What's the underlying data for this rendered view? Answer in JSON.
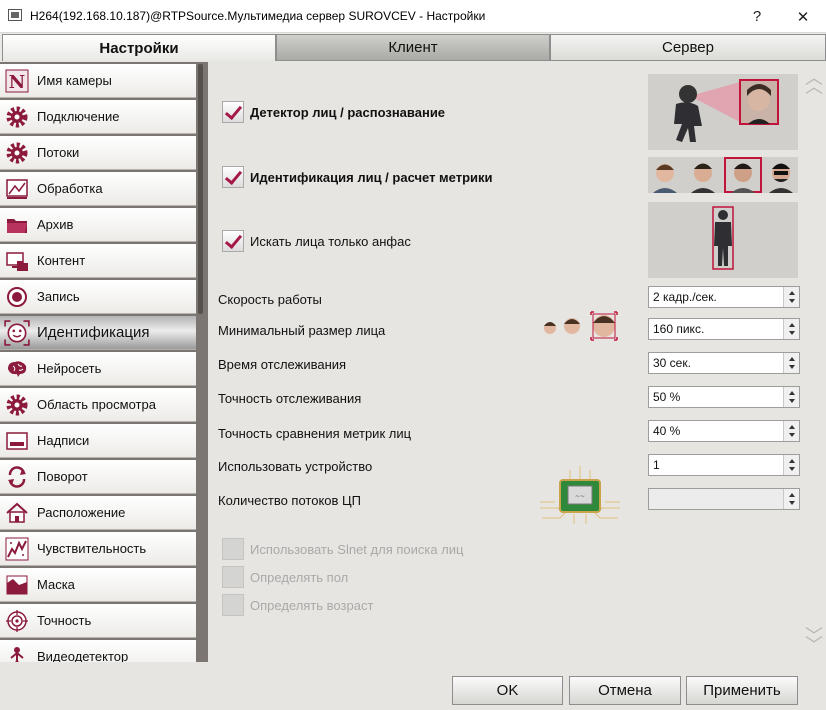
{
  "window": {
    "title": "H264(192.168.10.187)@RTPSource.Мультимедиа сервер SUROVCEV - Настройки",
    "help_glyph": "?",
    "close_glyph": "✕"
  },
  "tabs": [
    {
      "label": "Настройки",
      "active": true
    },
    {
      "label": "Клиент",
      "active": false
    },
    {
      "label": "Сервер",
      "active": false
    }
  ],
  "sidebar": {
    "items": [
      {
        "label": "Имя камеры",
        "icon": "camera-name-icon"
      },
      {
        "label": "Подключение",
        "icon": "gear-icon"
      },
      {
        "label": "Потоки",
        "icon": "gear-icon"
      },
      {
        "label": "Обработка",
        "icon": "processing-icon"
      },
      {
        "label": "Архив",
        "icon": "folder-icon"
      },
      {
        "label": "Контент",
        "icon": "content-icon"
      },
      {
        "label": "Запись",
        "icon": "record-icon"
      },
      {
        "label": "Идентификация",
        "icon": "face-icon",
        "active": true
      },
      {
        "label": "Нейросеть",
        "icon": "brain-icon"
      },
      {
        "label": "Область просмотра",
        "icon": "gear-icon"
      },
      {
        "label": "Надписи",
        "icon": "captions-icon"
      },
      {
        "label": "Поворот",
        "icon": "rotate-icon"
      },
      {
        "label": "Расположение",
        "icon": "home-icon"
      },
      {
        "label": "Чувствительность",
        "icon": "sensitivity-icon"
      },
      {
        "label": "Маска",
        "icon": "mask-icon"
      },
      {
        "label": "Точность",
        "icon": "target-icon"
      },
      {
        "label": "Видеодетектор",
        "icon": "motion-detector-icon"
      }
    ]
  },
  "options": {
    "face_detector": {
      "label": "Детектор лиц / распознавание",
      "checked": true
    },
    "face_identification": {
      "label": "Идентификация лиц / расчет метрики",
      "checked": true
    },
    "frontal_only": {
      "label": "Искать лица только анфас",
      "checked": true
    },
    "use_slnet": {
      "label": "Использовать Slnet для поиска лиц",
      "checked": false,
      "disabled": true
    },
    "detect_gender": {
      "label": "Определять пол",
      "checked": false,
      "disabled": true
    },
    "detect_age": {
      "label": "Определять возраст",
      "checked": false,
      "disabled": true
    }
  },
  "params": [
    {
      "label": "Скорость работы",
      "value": "2 кадр./сек."
    },
    {
      "label": "Минимальный размер лица",
      "value": "160 пикс."
    },
    {
      "label": "Время отслеживания",
      "value": "30 сек."
    },
    {
      "label": "Точность отслеживания",
      "value": "50 %"
    },
    {
      "label": "Точность сравнения метрик лиц",
      "value": "40 %"
    },
    {
      "label": "Использовать устройство",
      "value": "1"
    },
    {
      "label": "Количество потоков ЦП",
      "value": ""
    }
  ],
  "buttons": {
    "ok": "OK",
    "cancel": "Отмена",
    "apply": "Применить"
  },
  "colors": {
    "accent": "#a4184a",
    "sidebar_bg": "#7b7671",
    "panel_bg": "#e6e5e2"
  }
}
